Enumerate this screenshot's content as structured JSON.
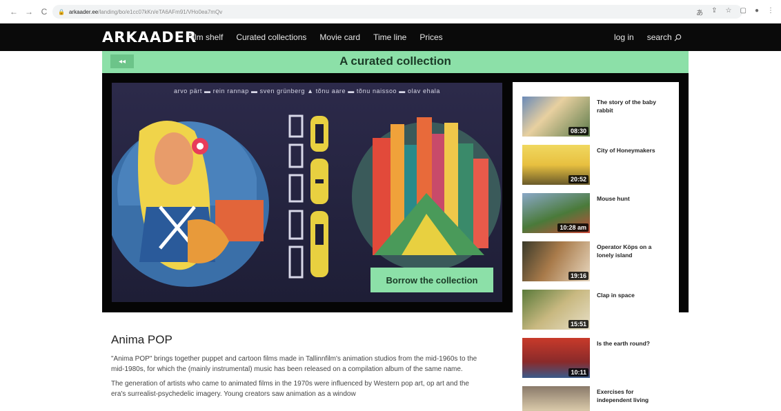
{
  "browser": {
    "url_domain": "arkaader.ee",
    "url_path": "/landing/bo/e1cc07kKn/eTA6AFm91/VHo0ea7mQv"
  },
  "site": {
    "logo": "ARKAADER",
    "menu": [
      "Film shelf",
      "Curated collections",
      "Movie card",
      "Time line",
      "Prices"
    ],
    "login": "log in",
    "search": "search"
  },
  "collection": {
    "back": "◂◂",
    "title": "A curated collection",
    "artists": "arvo pärt  ▬  rein rannap  ▬  sven grünberg  ▲  tõnu aare  ▬  tõnu naissoo  ▬  olav ehala",
    "borrow": "Borrow the collection"
  },
  "playlist": [
    {
      "title": "The story of the baby rabbit",
      "duration": "08:30"
    },
    {
      "title": "City of Honeymakers",
      "duration": "20:52"
    },
    {
      "title": "Mouse hunt",
      "duration": "10:28 am"
    },
    {
      "title": "Operator Köps on a lonely island",
      "duration": "19:16"
    },
    {
      "title": "Clap in space",
      "duration": "15:51"
    },
    {
      "title": "Is the earth round?",
      "duration": "10:11"
    },
    {
      "title": "Exercises for independent living",
      "duration": ""
    }
  ],
  "description": {
    "heading": "Anima POP",
    "p1": "\"Anima POP\" brings together puppet and cartoon films made in Tallinnfilm's animation studios from the mid-1960s to the mid-1980s, for which the (mainly instrumental) music has been released on a compilation album of the same name.",
    "p2": "The generation of artists who came to animated films in the 1970s were influenced by Western pop art, op art and the era's surrealist-psychedelic imagery. Young creators saw animation as a window"
  },
  "colors": {
    "accent_green": "#8ce0a8",
    "nav_black": "#0a0a0a"
  }
}
